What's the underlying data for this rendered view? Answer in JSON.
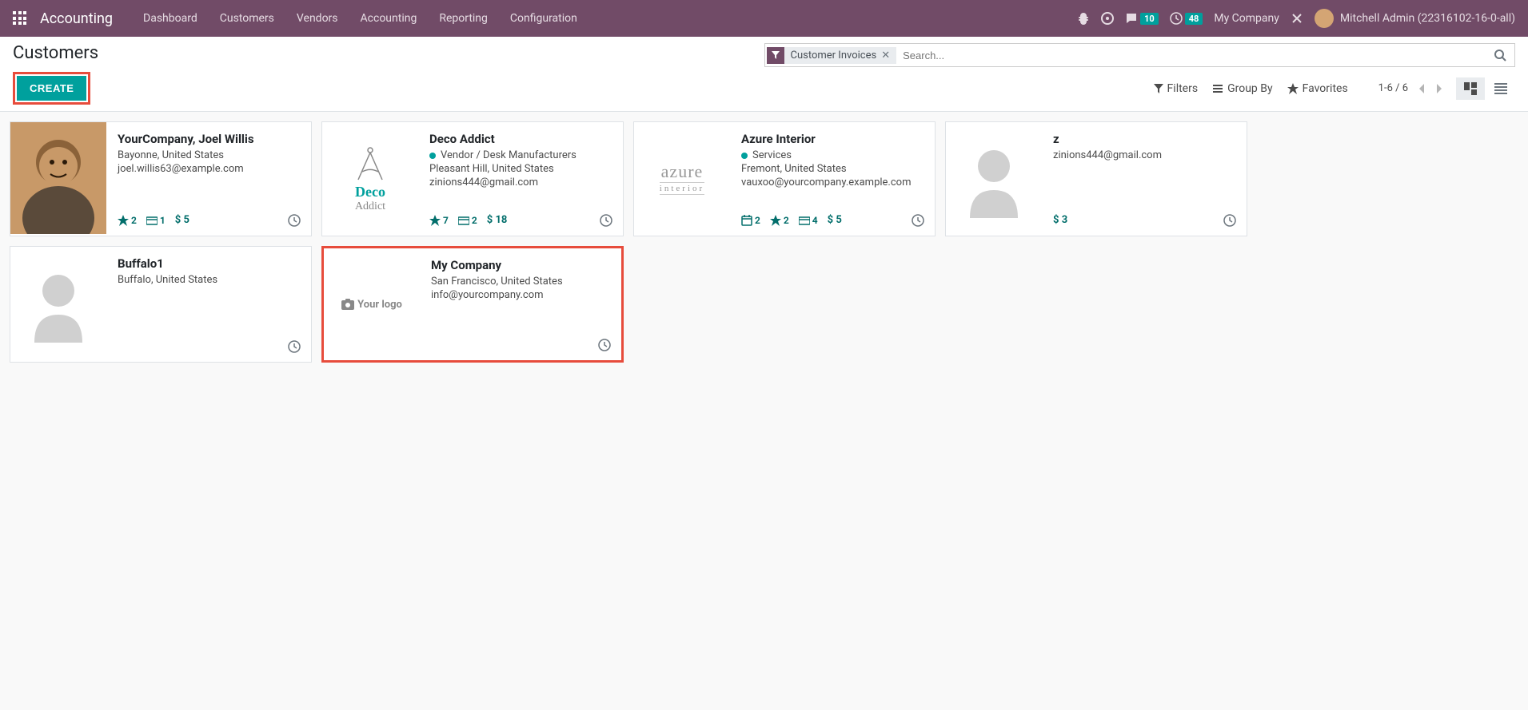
{
  "navbar": {
    "app_name": "Accounting",
    "menu": [
      "Dashboard",
      "Customers",
      "Vendors",
      "Accounting",
      "Reporting",
      "Configuration"
    ],
    "messages_count": "10",
    "activities_count": "48",
    "company": "My Company",
    "user": "Mitchell Admin (22316102-16-0-all)"
  },
  "breadcrumb": "Customers",
  "create_button": "CREATE",
  "search": {
    "facet_label": "Customer Invoices",
    "placeholder": "Search..."
  },
  "toolbar": {
    "filters": "Filters",
    "group_by": "Group By",
    "favorites": "Favorites",
    "pager": "1-6 / 6"
  },
  "cards": [
    {
      "name": "YourCompany, Joel Willis",
      "location": "Bayonne, United States",
      "email": "joel.willis63@example.com",
      "star": "2",
      "card_count": "1",
      "amount": "$  5",
      "avatar_type": "photo"
    },
    {
      "name": "Deco Addict",
      "tag": "Vendor / Desk Manufacturers",
      "location": "Pleasant Hill, United States",
      "email": "zinions444@gmail.com",
      "star": "7",
      "card_count": "2",
      "amount": "$  18",
      "avatar_type": "deco"
    },
    {
      "name": "Azure Interior",
      "tag": "Services",
      "location": "Fremont, United States",
      "email": "vauxoo@yourcompany.example.com",
      "calendar": "2",
      "star": "2",
      "card_count": "4",
      "amount": "$  5",
      "avatar_type": "azure"
    },
    {
      "name": "z",
      "email": "zinions444@gmail.com",
      "amount": "$  3",
      "avatar_type": "placeholder"
    },
    {
      "name": "Buffalo1",
      "location": "Buffalo, United States",
      "avatar_type": "placeholder"
    },
    {
      "name": "My Company",
      "location": "San Francisco, United States",
      "email": "info@yourcompany.com",
      "avatar_type": "yourlogo",
      "highlighted": true
    }
  ],
  "logo_text": {
    "deco1": "Deco",
    "deco2": "Addict",
    "azure1": "azure",
    "azure2": "interior",
    "yourlogo": "Your logo"
  }
}
